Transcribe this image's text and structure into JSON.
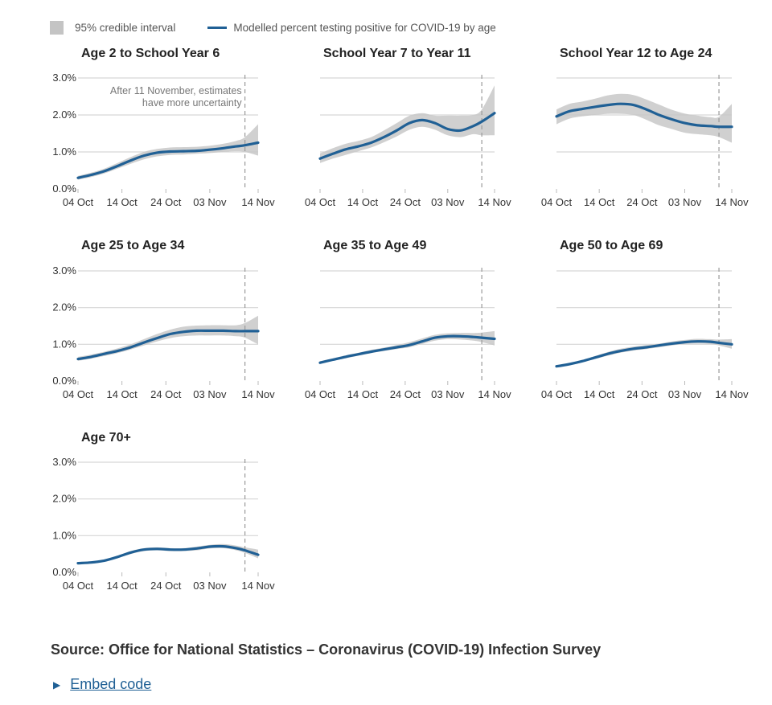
{
  "legend": {
    "interval_label": "95% credible interval",
    "line_label": "Modelled percent testing positive for COVID-19 by age"
  },
  "annotation": {
    "line1": "After 11 November, estimates",
    "line2": "have more uncertainty"
  },
  "source": "Source: Office for National Statistics – Coronavirus (COVID-19) Infection Survey",
  "embed_label": "Embed code",
  "colors": {
    "line": "#206095",
    "interval": "#c8c8c8",
    "grid": "#d6d6d6",
    "marker": "#9a9a9a"
  },
  "chart_data": {
    "type": "line",
    "x_ticks": [
      "04 Oct",
      "14 Oct",
      "24 Oct",
      "03 Nov",
      "14 Nov"
    ],
    "x_tick_days": [
      0,
      10,
      20,
      30,
      41
    ],
    "y_ticks": [
      "0.0%",
      "1.0%",
      "2.0%",
      "3.0%"
    ],
    "ylim": [
      0,
      3
    ],
    "uncertainty_marker_day": 38,
    "days": [
      0,
      3,
      6,
      9,
      12,
      15,
      18,
      21,
      24,
      27,
      30,
      33,
      36,
      38,
      41
    ],
    "panels": [
      {
        "title": "Age 2 to School Year 6",
        "show_y_axis": true,
        "show_annotation": true,
        "values": [
          0.3,
          0.38,
          0.48,
          0.62,
          0.77,
          0.9,
          0.98,
          1.01,
          1.02,
          1.03,
          1.06,
          1.1,
          1.15,
          1.18,
          1.25
        ],
        "lower": [
          0.25,
          0.32,
          0.42,
          0.55,
          0.68,
          0.8,
          0.88,
          0.92,
          0.93,
          0.95,
          0.97,
          1.0,
          1.02,
          1.0,
          0.9
        ],
        "upper": [
          0.35,
          0.44,
          0.55,
          0.7,
          0.86,
          1.0,
          1.08,
          1.12,
          1.13,
          1.14,
          1.17,
          1.22,
          1.3,
          1.4,
          1.75
        ]
      },
      {
        "title": "School Year 7 to Year 11",
        "show_y_axis": false,
        "show_annotation": false,
        "values": [
          0.82,
          0.95,
          1.07,
          1.15,
          1.25,
          1.4,
          1.58,
          1.78,
          1.86,
          1.78,
          1.62,
          1.58,
          1.7,
          1.82,
          2.05
        ],
        "lower": [
          0.7,
          0.82,
          0.92,
          1.02,
          1.12,
          1.26,
          1.42,
          1.6,
          1.68,
          1.6,
          1.45,
          1.4,
          1.48,
          1.45,
          1.45
        ],
        "upper": [
          0.96,
          1.1,
          1.22,
          1.3,
          1.4,
          1.58,
          1.78,
          1.98,
          2.05,
          1.98,
          1.98,
          1.98,
          2.0,
          2.15,
          2.8
        ]
      },
      {
        "title": "School Year 12 to Age 24",
        "show_y_axis": false,
        "show_annotation": false,
        "values": [
          1.96,
          2.1,
          2.16,
          2.22,
          2.27,
          2.3,
          2.27,
          2.15,
          2.0,
          1.88,
          1.78,
          1.72,
          1.7,
          1.68,
          1.68
        ],
        "lower": [
          1.75,
          1.9,
          1.96,
          2.0,
          2.03,
          2.03,
          2.0,
          1.87,
          1.72,
          1.62,
          1.52,
          1.48,
          1.45,
          1.4,
          1.25
        ],
        "upper": [
          2.15,
          2.3,
          2.36,
          2.44,
          2.53,
          2.57,
          2.54,
          2.42,
          2.28,
          2.14,
          2.04,
          1.98,
          1.94,
          1.95,
          2.3
        ]
      },
      {
        "title": "Age 25 to Age 34",
        "show_y_axis": true,
        "show_annotation": false,
        "values": [
          0.6,
          0.66,
          0.74,
          0.82,
          0.92,
          1.05,
          1.17,
          1.28,
          1.34,
          1.37,
          1.37,
          1.37,
          1.36,
          1.36,
          1.36
        ],
        "lower": [
          0.55,
          0.61,
          0.68,
          0.76,
          0.86,
          0.97,
          1.08,
          1.17,
          1.22,
          1.24,
          1.24,
          1.24,
          1.22,
          1.18,
          1.0
        ],
        "upper": [
          0.66,
          0.72,
          0.8,
          0.89,
          1.0,
          1.14,
          1.28,
          1.4,
          1.48,
          1.51,
          1.52,
          1.52,
          1.52,
          1.58,
          1.78
        ]
      },
      {
        "title": "Age 35 to Age 49",
        "show_y_axis": false,
        "show_annotation": false,
        "values": [
          0.5,
          0.58,
          0.66,
          0.73,
          0.8,
          0.86,
          0.92,
          0.98,
          1.08,
          1.18,
          1.22,
          1.22,
          1.2,
          1.18,
          1.15
        ],
        "lower": [
          0.47,
          0.55,
          0.62,
          0.69,
          0.76,
          0.82,
          0.87,
          0.92,
          1.01,
          1.1,
          1.14,
          1.13,
          1.1,
          1.06,
          0.97
        ],
        "upper": [
          0.54,
          0.62,
          0.7,
          0.77,
          0.85,
          0.91,
          0.98,
          1.06,
          1.16,
          1.26,
          1.3,
          1.31,
          1.31,
          1.32,
          1.36
        ]
      },
      {
        "title": "Age 50 to Age 69",
        "show_y_axis": false,
        "show_annotation": false,
        "values": [
          0.4,
          0.46,
          0.54,
          0.64,
          0.74,
          0.82,
          0.88,
          0.92,
          0.97,
          1.02,
          1.06,
          1.08,
          1.07,
          1.04,
          1.0
        ],
        "lower": [
          0.38,
          0.43,
          0.51,
          0.6,
          0.69,
          0.77,
          0.83,
          0.87,
          0.92,
          0.97,
          1.01,
          1.02,
          1.01,
          0.97,
          0.88
        ],
        "upper": [
          0.43,
          0.49,
          0.57,
          0.68,
          0.79,
          0.88,
          0.94,
          0.98,
          1.02,
          1.08,
          1.12,
          1.15,
          1.14,
          1.13,
          1.14
        ]
      },
      {
        "title": "Age 70+",
        "show_y_axis": true,
        "show_annotation": false,
        "values": [
          0.25,
          0.27,
          0.32,
          0.42,
          0.54,
          0.62,
          0.64,
          0.62,
          0.62,
          0.65,
          0.7,
          0.71,
          0.66,
          0.6,
          0.48
        ],
        "lower": [
          0.23,
          0.25,
          0.3,
          0.39,
          0.5,
          0.58,
          0.6,
          0.58,
          0.58,
          0.6,
          0.65,
          0.66,
          0.6,
          0.53,
          0.38
        ],
        "upper": [
          0.27,
          0.29,
          0.35,
          0.45,
          0.58,
          0.66,
          0.68,
          0.66,
          0.66,
          0.7,
          0.75,
          0.77,
          0.73,
          0.68,
          0.62
        ]
      }
    ]
  }
}
